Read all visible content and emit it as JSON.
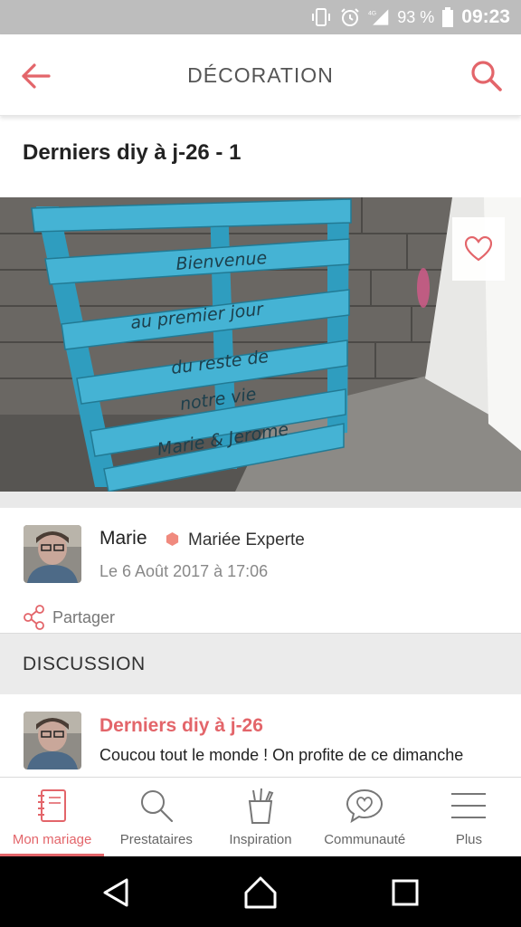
{
  "status_bar": {
    "network": "4G",
    "battery": "93 %",
    "time": "09:23",
    "icons": [
      "vibrate-icon",
      "alarm-icon",
      "signal-icon",
      "battery-icon"
    ]
  },
  "header": {
    "title": "DÉCORATION",
    "back_icon": "arrow-left-icon",
    "search_icon": "search-icon",
    "accent_color": "#e3656a"
  },
  "post": {
    "title": "Derniers diy à j-26 - 1",
    "photo_text_lines": [
      "Bienvenue",
      "au premier jour",
      "du reste de",
      "notre vie",
      "Marie & Jerome"
    ],
    "favorite_icon": "heart-outline-icon"
  },
  "author": {
    "name": "Marie",
    "badge": "Mariée Experte",
    "badge_color": "#f08a7e",
    "date": "Le 6 Août 2017 à 17:06"
  },
  "share": {
    "label": "Partager",
    "icon": "share-icon"
  },
  "discussion": {
    "section_title": "DISCUSSION",
    "item": {
      "title": "Derniers diy à j-26",
      "snippet": "Coucou tout le monde ! On profite de ce dimanche"
    }
  },
  "bottom_nav": {
    "items": [
      {
        "label": "Mon mariage",
        "icon": "notebook-icon",
        "active": true
      },
      {
        "label": "Prestataires",
        "icon": "search-icon",
        "active": false
      },
      {
        "label": "Inspiration",
        "icon": "brush-cup-icon",
        "active": false
      },
      {
        "label": "Communauté",
        "icon": "heart-bubble-icon",
        "active": false
      },
      {
        "label": "Plus",
        "icon": "menu-icon",
        "active": false
      }
    ]
  },
  "android_nav": [
    "back-triangle-icon",
    "home-icon",
    "recents-icon"
  ]
}
